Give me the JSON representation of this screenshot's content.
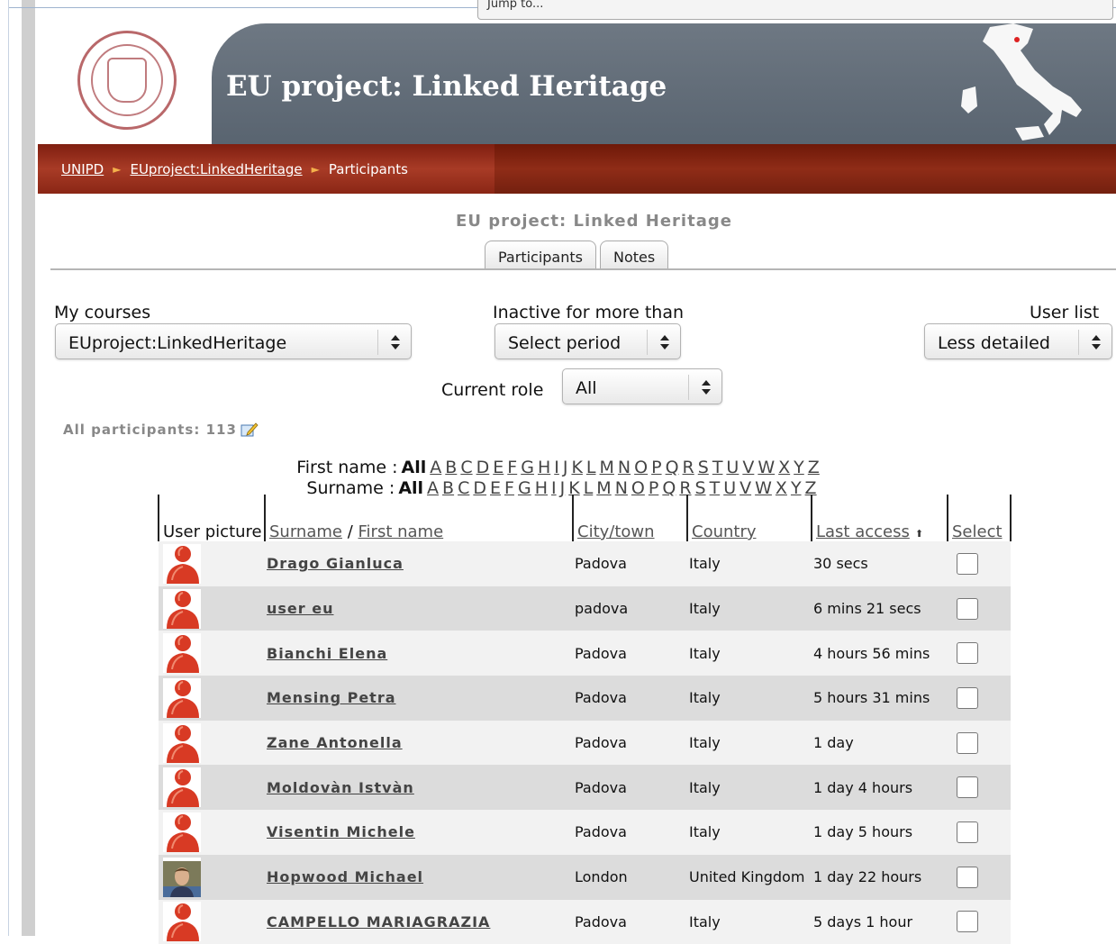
{
  "jump_to": {
    "label": "Jump to..."
  },
  "header": {
    "title": "EU project: Linked Heritage"
  },
  "breadcrumb": {
    "items": [
      "UNIPD",
      "EUproject:LinkedHeritage",
      "Participants"
    ]
  },
  "course_heading": "EU project: Linked Heritage",
  "tabs": [
    {
      "label": "Participants"
    },
    {
      "label": "Notes"
    }
  ],
  "filters": {
    "my_courses": {
      "label": "My courses",
      "value": "EUproject:LinkedHeritage"
    },
    "inactive": {
      "label": "Inactive for more than",
      "value": "Select period"
    },
    "user_list": {
      "label": "User list",
      "value": "Less detailed"
    },
    "current_role": {
      "label": "Current role",
      "value": "All"
    }
  },
  "participants_count": "All participants: 113",
  "initials": {
    "first_name_label": "First name :",
    "surname_label": "Surname :",
    "all": "All",
    "letters": [
      "A",
      "B",
      "C",
      "D",
      "E",
      "F",
      "G",
      "H",
      "I",
      "J",
      "K",
      "L",
      "M",
      "N",
      "O",
      "P",
      "Q",
      "R",
      "S",
      "T",
      "U",
      "V",
      "W",
      "X",
      "Y",
      "Z"
    ]
  },
  "table": {
    "headers": {
      "picture": "User picture",
      "surname": "Surname",
      "slash": "/",
      "firstname": "First name",
      "city": "City/town",
      "country": "Country",
      "last_access": "Last access",
      "select": "Select"
    },
    "rows": [
      {
        "name": "Drago Gianluca",
        "city": "Padova",
        "country": "Italy",
        "last_access": "30 secs",
        "photo": false
      },
      {
        "name": "user eu",
        "city": "padova",
        "country": "Italy",
        "last_access": "6 mins 21 secs",
        "photo": false
      },
      {
        "name": "Bianchi Elena",
        "city": "Padova",
        "country": "Italy",
        "last_access": "4 hours 56 mins",
        "photo": false
      },
      {
        "name": "Mensing Petra",
        "city": "Padova",
        "country": "Italy",
        "last_access": "5 hours 31 mins",
        "photo": false
      },
      {
        "name": "Zane Antonella",
        "city": "Padova",
        "country": "Italy",
        "last_access": "1 day",
        "photo": false
      },
      {
        "name": "Moldovàn Istvàn",
        "city": "Padova",
        "country": "Italy",
        "last_access": "1 day 4 hours",
        "photo": false
      },
      {
        "name": "Visentin Michele",
        "city": "Padova",
        "country": "Italy",
        "last_access": "1 day 5 hours",
        "photo": false
      },
      {
        "name": "Hopwood Michael",
        "city": "London",
        "country": "United Kingdom",
        "last_access": "1 day 22 hours",
        "photo": true
      },
      {
        "name": "CAMPELLO MARIAGRAZIA",
        "city": "Padova",
        "country": "Italy",
        "last_access": "5 days 1 hour",
        "photo": false
      }
    ]
  }
}
